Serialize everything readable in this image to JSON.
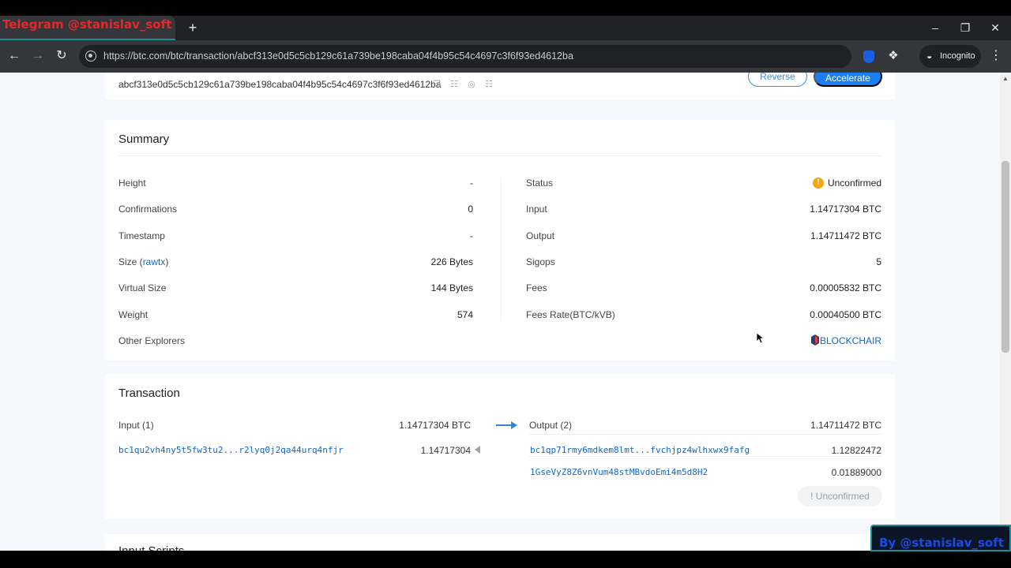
{
  "browser": {
    "tab_title": "Telegram @stanislav_soft",
    "new_tab_icon": "+",
    "url": "https://btc.com/btc/transaction/abcf313e0d5c5cb129c61a739be198caba04f4b95c54c4697c3f6f93ed4612ba",
    "incognito_label": "Incognito"
  },
  "header": {
    "tx_hash": "abcf313e0d5c5cb129c61a739be198caba04f4b95c54c4697c3f6f93ed4612ba",
    "reverse_label": "Reverse",
    "accelerate_label": "Accelerate"
  },
  "summary": {
    "title": "Summary",
    "left": [
      {
        "label": "Height",
        "value": "-"
      },
      {
        "label": "Confirmations",
        "value": "0"
      },
      {
        "label": "Timestamp",
        "value": "-"
      },
      {
        "label": "Size",
        "value": "226 Bytes"
      },
      {
        "label": "Virtual Size",
        "value": "144 Bytes"
      },
      {
        "label": "Weight",
        "value": "574"
      },
      {
        "label": "Other Explorers",
        "value": ""
      }
    ],
    "size_link": "rawtx",
    "right": [
      {
        "label": "Status",
        "value": "Unconfirmed"
      },
      {
        "label": "Input",
        "value": "1.14717304 BTC"
      },
      {
        "label": "Output",
        "value": "1.14711472 BTC"
      },
      {
        "label": "Sigops",
        "value": "5"
      },
      {
        "label": "Fees",
        "value": "0.00005832 BTC"
      },
      {
        "label": "Fees Rate(BTC/kVB)",
        "value": "0.00040500 BTC"
      }
    ],
    "status_icon": "!",
    "explorer_link": "BLOCKCHAIR"
  },
  "transaction": {
    "title": "Transaction",
    "input_header": "Input (1)",
    "input_total": "1.14717304 BTC",
    "output_header": "Output (2)",
    "output_total": "1.14711472 BTC",
    "inputs": [
      {
        "address": "bc1qu2vh4ny5t5fw3tu2...r2lyq0j2qa44urq4nfjr",
        "amount": "1.14717304"
      }
    ],
    "outputs": [
      {
        "address": "bc1qp71rmy6mdkem8lmt...fvchjpz4wlhxwx9fafg",
        "amount": "1.12822472"
      },
      {
        "address": "1GseVyZ8Z6vnVum48stMBvdoEmi4m5d8H2",
        "amount": "0.01889000"
      }
    ],
    "unconfirmed_label": "! Unconfirmed"
  },
  "input_scripts": {
    "title": "Input Scripts"
  },
  "watermark": {
    "text": "By @stanislav_soft"
  },
  "colors": {
    "accent": "#1c7ff0",
    "link": "#1565c0",
    "status_warning": "#f2a515"
  }
}
